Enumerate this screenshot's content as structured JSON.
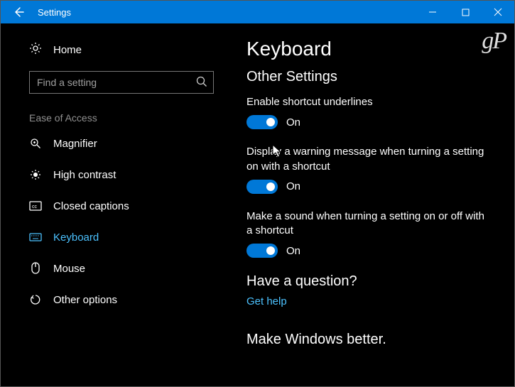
{
  "titlebar": {
    "title": "Settings"
  },
  "sidebar": {
    "home_label": "Home",
    "search_placeholder": "Find a setting",
    "category_label": "Ease of Access",
    "items": [
      {
        "icon": "magnifier-icon",
        "label": "Magnifier"
      },
      {
        "icon": "highcontrast-icon",
        "label": "High contrast"
      },
      {
        "icon": "closedcaptions-icon",
        "label": "Closed captions"
      },
      {
        "icon": "keyboard-icon",
        "label": "Keyboard"
      },
      {
        "icon": "mouse-icon",
        "label": "Mouse"
      },
      {
        "icon": "otheroptions-icon",
        "label": "Other options"
      }
    ]
  },
  "main": {
    "page_title": "Keyboard",
    "section_title": "Other Settings",
    "settings": [
      {
        "label": "Enable shortcut underlines",
        "state": "On"
      },
      {
        "label": "Display a warning message when turning a setting on with a shortcut",
        "state": "On"
      },
      {
        "label": "Make a sound when turning a setting on or off with a shortcut",
        "state": "On"
      }
    ],
    "help": {
      "title": "Have a question?",
      "link": "Get help"
    },
    "feedback_title": "Make Windows better."
  },
  "watermark": "gP"
}
